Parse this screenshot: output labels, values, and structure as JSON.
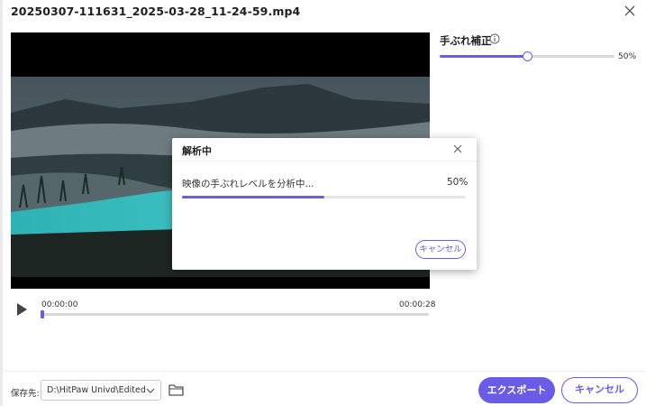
{
  "window": {
    "title": "20250307-111631_2025-03-28_11-24-59.mp4"
  },
  "player": {
    "time_current": "00:00:00",
    "time_total": "00:00:28",
    "playhead_fraction": 0
  },
  "stabilization": {
    "label": "手ぶれ補正",
    "value_text": "50%",
    "value_fraction": 0.5
  },
  "modal": {
    "title": "解析中",
    "message": "映像の手ぶれレベルを分析中...",
    "percent_text": "50%",
    "progress_fraction": 0.5,
    "cancel_label": "キャンセル"
  },
  "footer": {
    "save_label": "保存先:",
    "path_value": "D:\\HitPaw Univd\\Edited",
    "export_label": "エクスポート",
    "cancel_label": "キャンセル"
  },
  "colors": {
    "accent": "#6b5ce7"
  },
  "icons": {
    "close": "close-icon",
    "info": "info-icon",
    "play": "play-icon",
    "chevron": "chevron-down-icon",
    "folder": "folder-icon"
  }
}
